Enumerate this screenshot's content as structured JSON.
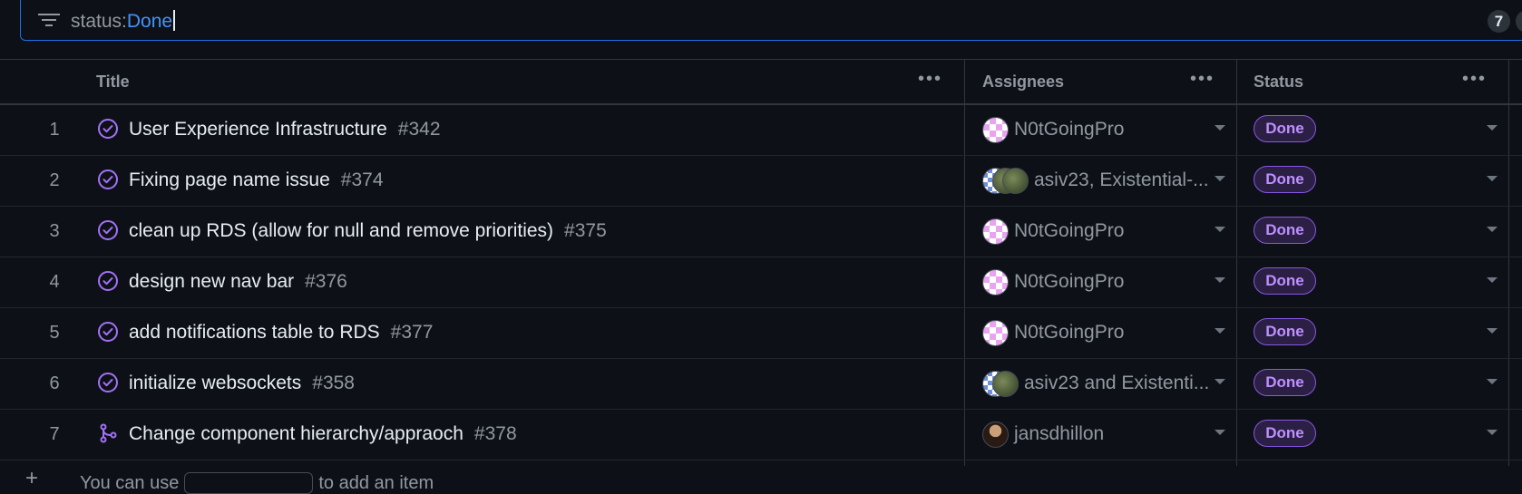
{
  "filter": {
    "prefix": "status:",
    "value": "Done",
    "count": "7"
  },
  "columns": {
    "title": "Title",
    "assignees": "Assignees",
    "status": "Status",
    "menu": "•••"
  },
  "rows": [
    {
      "num": "1",
      "icon": "closed-issue-icon",
      "title": "User Experience Infrastructure",
      "ref": "#342",
      "assignees": "N0tGoingPro",
      "avatars": [
        "pink"
      ],
      "status": "Done"
    },
    {
      "num": "2",
      "icon": "closed-issue-icon",
      "title": "Fixing page name issue",
      "ref": "#374",
      "assignees": "asiv23, Existential-...",
      "avatars": [
        "blue",
        "green",
        "green"
      ],
      "status": "Done"
    },
    {
      "num": "3",
      "icon": "closed-issue-icon",
      "title": "clean up RDS (allow for null and remove priorities)",
      "ref": "#375",
      "assignees": "N0tGoingPro",
      "avatars": [
        "pink"
      ],
      "status": "Done"
    },
    {
      "num": "4",
      "icon": "closed-issue-icon",
      "title": "design new nav bar",
      "ref": "#376",
      "assignees": "N0tGoingPro",
      "avatars": [
        "pink"
      ],
      "status": "Done"
    },
    {
      "num": "5",
      "icon": "closed-issue-icon",
      "title": "add notifications table to RDS",
      "ref": "#377",
      "assignees": "N0tGoingPro",
      "avatars": [
        "pink"
      ],
      "status": "Done"
    },
    {
      "num": "6",
      "icon": "closed-issue-icon",
      "title": "initialize websockets",
      "ref": "#358",
      "assignees": "asiv23 and Existenti...",
      "avatars": [
        "blue",
        "green"
      ],
      "status": "Done"
    },
    {
      "num": "7",
      "icon": "merged-pr-icon",
      "title": "Change component hierarchy/appraoch",
      "ref": "#378",
      "assignees": "jansdhillon",
      "avatars": [
        "photo"
      ],
      "status": "Done"
    }
  ],
  "add_item": {
    "plus": "+",
    "before": "You can use",
    "after": "to add an item"
  }
}
